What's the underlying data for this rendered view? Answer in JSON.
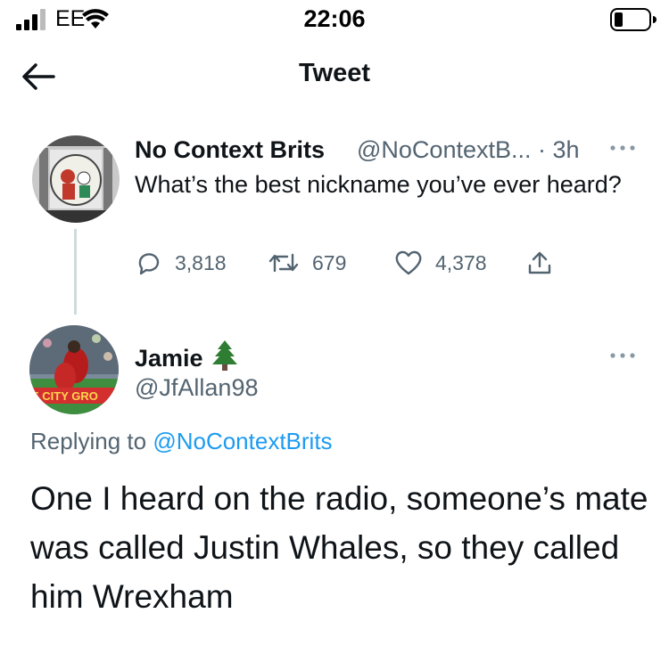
{
  "status_bar": {
    "carrier": "EE",
    "time": "22:06",
    "icons": [
      "signal-icon",
      "wifi-icon",
      "battery-icon"
    ]
  },
  "header": {
    "title": "Tweet",
    "back_icon": "arrow-left-icon"
  },
  "original_tweet": {
    "display_name": "No Context Brits",
    "handle_time": "@NoContextB... · 3h",
    "text": "What’s the best nickname you’ve ever heard?",
    "replies": "3,818",
    "retweets": "679",
    "likes": "4,378"
  },
  "reply_tweet": {
    "display_name": "Jamie",
    "name_emoji": "🌲",
    "handle": "@JfAllan98",
    "replying_prefix": "Replying to",
    "replying_to": "@NoContextBrits",
    "text": "One I heard on the radio, someone’s mate was called Justin Whales, so they called him Wrexham",
    "avatar_text": "E CITY GRO"
  },
  "colors": {
    "accent": "#1d9bf0",
    "secondary_text": "#536471",
    "primary_text": "#0f1419",
    "thread_line": "#cfd9de",
    "tree_green": "#2e7d32"
  }
}
